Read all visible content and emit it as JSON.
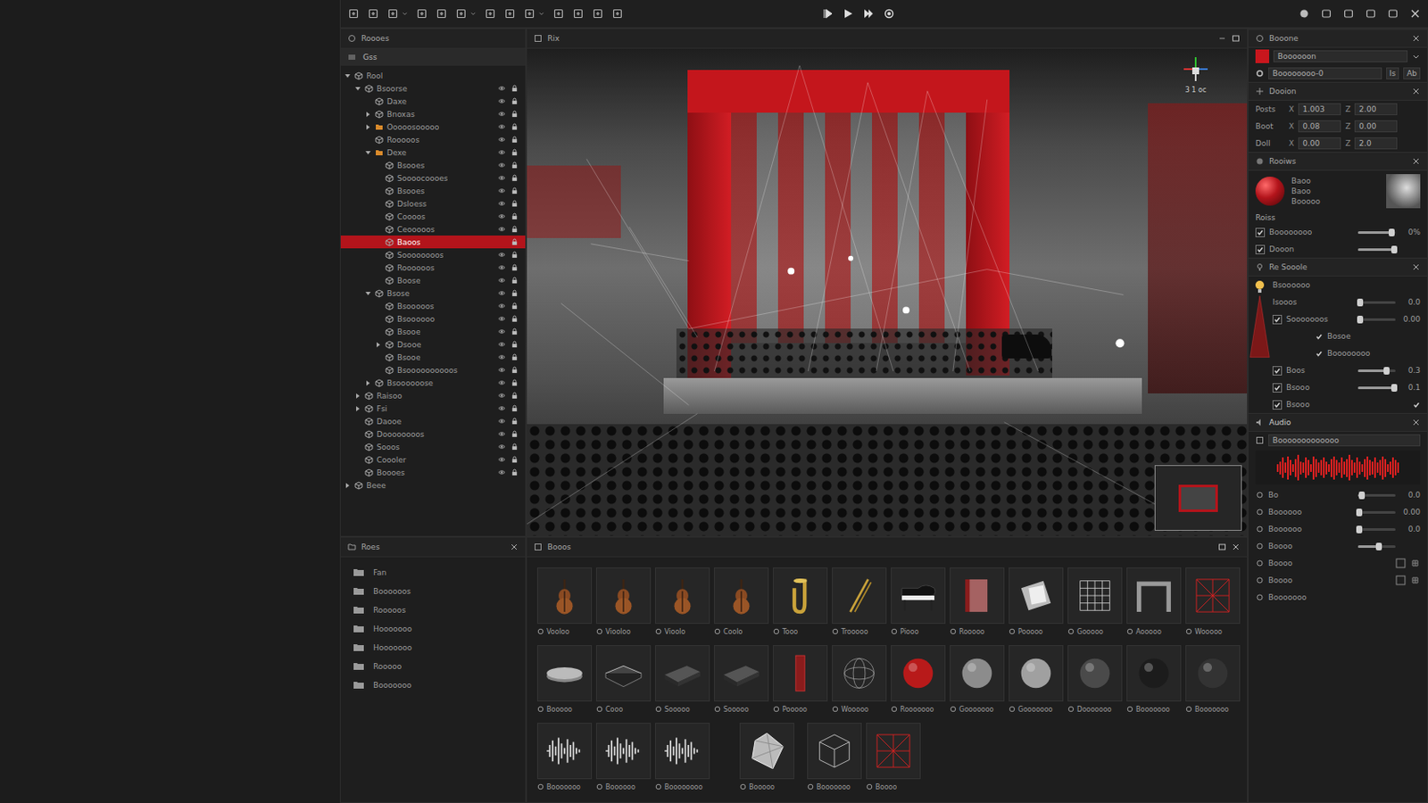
{
  "hierarchy": {
    "title": "Roooes",
    "scene": "Gss",
    "items": [
      {
        "label": "Rool",
        "depth": 0,
        "kind": "object",
        "expandable": true,
        "expanded": true,
        "selected": false,
        "visible": false,
        "locked": false
      },
      {
        "label": "Bsoorse",
        "depth": 1,
        "kind": "object",
        "expandable": true,
        "expanded": true,
        "selected": false,
        "visible": true,
        "locked": true
      },
      {
        "label": "Daxe",
        "depth": 2,
        "kind": "object",
        "expandable": false,
        "expanded": false,
        "selected": false,
        "visible": true,
        "locked": true
      },
      {
        "label": "Bnoxas",
        "depth": 2,
        "kind": "object",
        "expandable": true,
        "expanded": false,
        "selected": false,
        "visible": true,
        "locked": true
      },
      {
        "label": "Ooooosooooo",
        "depth": 2,
        "kind": "folder",
        "expandable": true,
        "expanded": false,
        "selected": false,
        "visible": true,
        "locked": true
      },
      {
        "label": "Rooooos",
        "depth": 2,
        "kind": "object",
        "expandable": false,
        "expanded": false,
        "selected": false,
        "visible": true,
        "locked": true
      },
      {
        "label": "Dexe",
        "depth": 2,
        "kind": "folder",
        "expandable": true,
        "expanded": true,
        "selected": false,
        "visible": true,
        "locked": true
      },
      {
        "label": "Bsooes",
        "depth": 3,
        "kind": "object",
        "expandable": false,
        "expanded": false,
        "selected": false,
        "visible": true,
        "locked": true
      },
      {
        "label": "Soooocoooes",
        "depth": 3,
        "kind": "object",
        "expandable": false,
        "expanded": false,
        "selected": false,
        "visible": true,
        "locked": true
      },
      {
        "label": "Bsooes",
        "depth": 3,
        "kind": "object",
        "expandable": false,
        "expanded": false,
        "selected": false,
        "visible": true,
        "locked": true
      },
      {
        "label": "Dsloess",
        "depth": 3,
        "kind": "object",
        "expandable": false,
        "expanded": false,
        "selected": false,
        "visible": true,
        "locked": true
      },
      {
        "label": "Coooos",
        "depth": 3,
        "kind": "object",
        "expandable": false,
        "expanded": false,
        "selected": false,
        "visible": true,
        "locked": true
      },
      {
        "label": "Ceooooos",
        "depth": 3,
        "kind": "object",
        "expandable": false,
        "expanded": false,
        "selected": false,
        "visible": true,
        "locked": true
      },
      {
        "label": "Baoos",
        "depth": 3,
        "kind": "object",
        "expandable": false,
        "expanded": false,
        "selected": true,
        "visible": false,
        "locked": true
      },
      {
        "label": "Soooooooos",
        "depth": 3,
        "kind": "object",
        "expandable": false,
        "expanded": false,
        "selected": false,
        "visible": true,
        "locked": true
      },
      {
        "label": "Roooooos",
        "depth": 3,
        "kind": "object",
        "expandable": false,
        "expanded": false,
        "selected": false,
        "visible": true,
        "locked": true
      },
      {
        "label": "Boose",
        "depth": 3,
        "kind": "object",
        "expandable": false,
        "expanded": false,
        "selected": false,
        "visible": true,
        "locked": true
      },
      {
        "label": "Bsose",
        "depth": 2,
        "kind": "object",
        "expandable": true,
        "expanded": true,
        "selected": false,
        "visible": true,
        "locked": true
      },
      {
        "label": "Bsooooos",
        "depth": 3,
        "kind": "object",
        "expandable": false,
        "expanded": false,
        "selected": false,
        "visible": true,
        "locked": true
      },
      {
        "label": "Bsoooooo",
        "depth": 3,
        "kind": "object",
        "expandable": false,
        "expanded": false,
        "selected": false,
        "visible": true,
        "locked": true
      },
      {
        "label": "Bsooe",
        "depth": 3,
        "kind": "object",
        "expandable": false,
        "expanded": false,
        "selected": false,
        "visible": true,
        "locked": true
      },
      {
        "label": "Dsooe",
        "depth": 3,
        "kind": "object",
        "expandable": true,
        "expanded": false,
        "selected": false,
        "visible": true,
        "locked": true
      },
      {
        "label": "Bsooe",
        "depth": 3,
        "kind": "object",
        "expandable": false,
        "expanded": false,
        "selected": false,
        "visible": true,
        "locked": true
      },
      {
        "label": "Bsoooooooooos",
        "depth": 3,
        "kind": "object",
        "expandable": false,
        "expanded": false,
        "selected": false,
        "visible": true,
        "locked": true
      },
      {
        "label": "Bsoooooose",
        "depth": 2,
        "kind": "object",
        "expandable": true,
        "expanded": false,
        "selected": false,
        "visible": true,
        "locked": true
      },
      {
        "label": "Raisoo",
        "depth": 1,
        "kind": "object",
        "expandable": true,
        "expanded": false,
        "selected": false,
        "visible": true,
        "locked": true
      },
      {
        "label": "Fsi",
        "depth": 1,
        "kind": "object",
        "expandable": true,
        "expanded": false,
        "selected": false,
        "visible": true,
        "locked": true
      },
      {
        "label": "Daooe",
        "depth": 1,
        "kind": "object",
        "expandable": false,
        "expanded": false,
        "selected": false,
        "visible": true,
        "locked": true
      },
      {
        "label": "Doooooooos",
        "depth": 1,
        "kind": "object",
        "expandable": false,
        "expanded": false,
        "selected": false,
        "visible": true,
        "locked": true
      },
      {
        "label": "Sooos",
        "depth": 1,
        "kind": "object",
        "expandable": false,
        "expanded": false,
        "selected": false,
        "visible": true,
        "locked": true
      },
      {
        "label": "Coooler",
        "depth": 1,
        "kind": "object",
        "expandable": false,
        "expanded": false,
        "selected": false,
        "visible": true,
        "locked": true
      },
      {
        "label": "Boooes",
        "depth": 1,
        "kind": "object",
        "expandable": false,
        "expanded": false,
        "selected": false,
        "visible": true,
        "locked": true
      },
      {
        "label": "Beee",
        "depth": 0,
        "kind": "object",
        "expandable": true,
        "expanded": false,
        "selected": false,
        "visible": false,
        "locked": false
      }
    ]
  },
  "viewport": {
    "title": "Rix",
    "gizmo_label": "3 1 oc"
  },
  "folders": {
    "title": "Roes",
    "items": [
      "Fan",
      "Boooooos",
      "Rooooos",
      "Hooooooo",
      "Hooooooo",
      "Rooooo",
      "Booooooo"
    ]
  },
  "assets": {
    "title": "Booos",
    "rows": [
      [
        {
          "label": "Vooloo",
          "kind": "violin"
        },
        {
          "label": "Viooloo",
          "kind": "violin"
        },
        {
          "label": "Vioolo",
          "kind": "violin"
        },
        {
          "label": "Coolo",
          "kind": "violin"
        },
        {
          "label": "Tooo",
          "kind": "tuba"
        },
        {
          "label": "Trooooo",
          "kind": "trombone"
        },
        {
          "label": "Piooo",
          "kind": "piano"
        },
        {
          "label": "Rooooo",
          "kind": "panel-red"
        },
        {
          "label": "Pooooo",
          "kind": "panel-light"
        },
        {
          "label": "Gooooo",
          "kind": "grid"
        },
        {
          "label": "Aooooo",
          "kind": "arch"
        },
        {
          "label": "Wooooo",
          "kind": "wire-red"
        }
      ],
      [
        {
          "label": "Booooo",
          "kind": "platform"
        },
        {
          "label": "Cooo",
          "kind": "case"
        },
        {
          "label": "Sooooo",
          "kind": "slab"
        },
        {
          "label": "Sooooo",
          "kind": "slab"
        },
        {
          "label": "Pooooo",
          "kind": "pillar"
        },
        {
          "label": "Wooooo",
          "kind": "wire-sphere"
        },
        {
          "label": "Rooooooo",
          "kind": "sphere",
          "color": "#b81a1a"
        },
        {
          "label": "Gooooooo",
          "kind": "sphere",
          "color": "#8c8c8c"
        },
        {
          "label": "Gooooooo",
          "kind": "sphere",
          "color": "#a0a0a0"
        },
        {
          "label": "Dooooooo",
          "kind": "sphere",
          "color": "#4a4a4a"
        },
        {
          "label": "Booooooo",
          "kind": "sphere",
          "color": "#1c1c1c"
        },
        {
          "label": "Booooooo",
          "kind": "sphere",
          "color": "#333333"
        }
      ],
      [
        {
          "label": "Booooooo",
          "kind": "wave"
        },
        {
          "label": "Boooooo",
          "kind": "wave"
        },
        {
          "label": "Boooooooo",
          "kind": "wave"
        },
        {
          "label": "Booooo",
          "kind": "crystal"
        },
        {
          "label": "Booooooo",
          "kind": "cube"
        },
        {
          "label": "Boooo",
          "kind": "wire-red"
        }
      ]
    ]
  },
  "inspector": {
    "object": {
      "title": "Booone",
      "color": "#c8161d",
      "name": "Boooooon",
      "value": "Boooooooo-0",
      "buttons": [
        "Is",
        "Ab"
      ]
    },
    "transform": {
      "title": "Dooion",
      "axes": [
        "X",
        "Z"
      ],
      "rows": [
        {
          "label": "Posts",
          "x": "1.003",
          "z": "2.00"
        },
        {
          "label": "Boot",
          "x": "0.08",
          "z": "0.00"
        },
        {
          "label": "Doll",
          "x": "0.00",
          "z": "2.0"
        }
      ]
    },
    "material": {
      "title": "Rooiws",
      "fields": [
        "Baoo",
        "Baoo",
        "Booooo"
      ],
      "group": "Roiss",
      "rows": [
        {
          "label": "Boooooooo",
          "checked": true,
          "level": 0.88,
          "reading": "0%"
        },
        {
          "label": "Dooon",
          "checked": true,
          "level": 0.95,
          "reading": ""
        }
      ]
    },
    "light": {
      "title": "Re Sooole",
      "name": "Bsoooooo",
      "rows": [
        {
          "kind": "slider",
          "label": "Isooos",
          "checked": false,
          "level": 0.05,
          "reading": "0.0"
        },
        {
          "kind": "checkslider",
          "label": "Sooooooos",
          "checked": true,
          "level": 0.05,
          "reading": "0.00"
        },
        {
          "kind": "tick",
          "label": "Bosoe",
          "checked": true,
          "level": 0,
          "reading": ""
        },
        {
          "kind": "tick",
          "label": "Boooooooo",
          "checked": true,
          "level": 0,
          "reading": ""
        },
        {
          "kind": "checkslider",
          "label": "Boos",
          "checked": true,
          "level": 0.75,
          "reading": "0.3"
        },
        {
          "kind": "checkslider",
          "label": "Bsooo",
          "checked": true,
          "level": 0.95,
          "reading": "0.1"
        },
        {
          "kind": "boxtick",
          "label": "Bsooo",
          "checked": true,
          "level": 0,
          "reading": ""
        }
      ]
    },
    "audio": {
      "title": "Audio",
      "clip": "Booooooooooooo",
      "waveform": [
        0.3,
        0.5,
        0.8,
        0.4,
        0.9,
        0.6,
        0.3,
        0.7,
        1.0,
        0.5,
        0.4,
        0.8,
        0.6,
        0.3,
        0.9,
        0.7,
        0.4,
        0.6,
        0.8,
        0.5,
        0.3,
        0.7,
        0.9,
        0.6,
        0.4,
        0.8,
        0.5,
        0.7,
        1.0,
        0.6,
        0.4,
        0.8,
        0.5,
        0.3,
        0.7,
        0.9,
        0.6,
        0.5,
        0.8,
        0.4,
        0.6,
        0.9,
        0.7,
        0.3,
        0.5,
        0.8,
        0.6,
        0.4
      ],
      "rows": [
        {
          "kind": "slider",
          "label": "Bo",
          "level": 0.1,
          "reading": "0.0"
        },
        {
          "kind": "slider",
          "label": "Boooooo",
          "level": 0.02,
          "reading": "0.00"
        },
        {
          "kind": "slider",
          "label": "Boooooo",
          "level": 0.02,
          "reading": "0.0"
        },
        {
          "kind": "slider",
          "label": "Boooo",
          "level": 0.55,
          "reading": ""
        },
        {
          "kind": "buttons",
          "label": "Boooo",
          "level": 0,
          "reading": ""
        },
        {
          "kind": "buttons",
          "label": "Boooo",
          "level": 0,
          "reading": ""
        },
        {
          "kind": "label",
          "label": "Booooooo",
          "level": 0,
          "reading": ""
        }
      ]
    }
  }
}
